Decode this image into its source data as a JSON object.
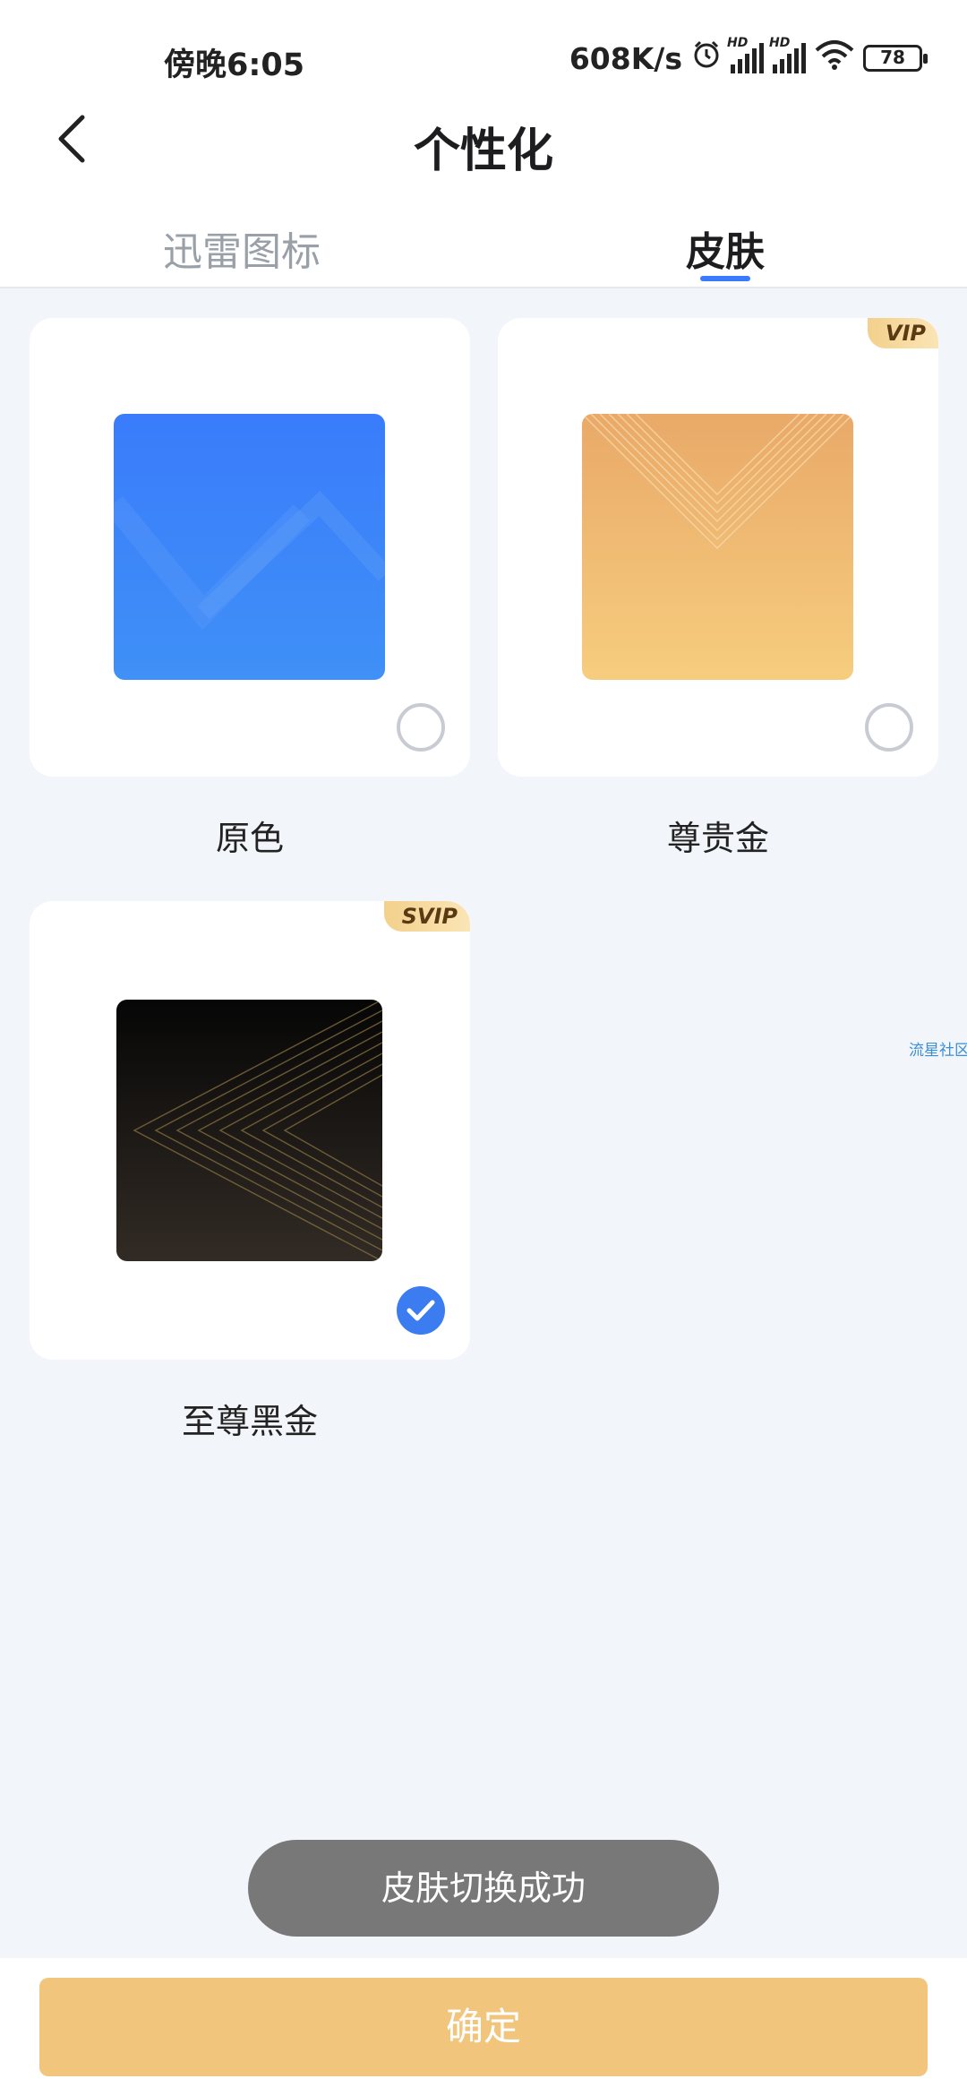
{
  "status_bar": {
    "time": "傍晚6:05",
    "network_speed": "608K/s",
    "battery": "78",
    "hd_label": "HD",
    "icons": [
      "alarm-icon",
      "signal-icon",
      "signal-icon",
      "wifi-icon",
      "battery-icon"
    ]
  },
  "header": {
    "title": "个性化",
    "back_icon": "chevron-left-icon"
  },
  "tabs": [
    {
      "label": "迅雷图标",
      "active": false
    },
    {
      "label": "皮肤",
      "active": true
    }
  ],
  "skins": [
    {
      "name": "原色",
      "badge": "",
      "selected": false,
      "theme_color": "#3a86fa"
    },
    {
      "name": "尊贵金",
      "badge": "VIP",
      "selected": false,
      "theme_color": "#f0b96d"
    },
    {
      "name": "至尊黑金",
      "badge": "SVIP",
      "selected": true,
      "theme_color": "#1c1a18"
    }
  ],
  "watermark": "流星社区",
  "toast": "皮肤切换成功",
  "confirm_button": "确定",
  "colors": {
    "accent": "#3a7afe",
    "confirm": "#f2c57d",
    "toast_bg": "#787878",
    "page_bg": "#f2f5f9"
  }
}
